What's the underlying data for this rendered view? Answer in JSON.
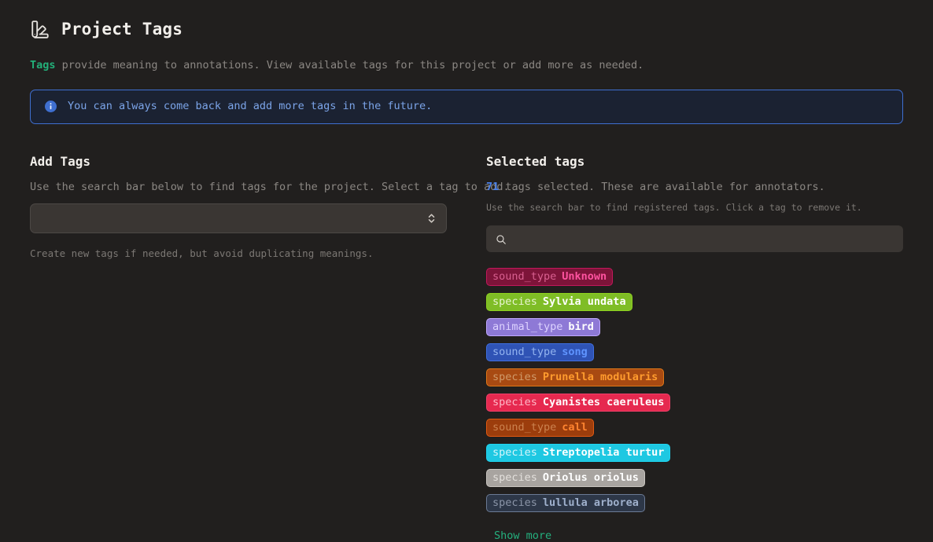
{
  "header": {
    "icon": "swatch-book-icon",
    "title": "Project Tags",
    "subtitle_keyword": "Tags",
    "subtitle_rest": " provide meaning to annotations. View available tags for this project or add more as needed."
  },
  "info_banner": {
    "icon": "info-circle-icon",
    "text": "You can always come back and add more tags in the future.",
    "border_color": "#3f6fd0",
    "background_color": "#1b2232",
    "text_color": "#7ba4e8"
  },
  "add_tags": {
    "title": "Add Tags",
    "description": "Use the search bar below to find tags for the project. Select a tag to add.",
    "select": {
      "value": "",
      "placeholder": "",
      "icon": "chevron-up-down-icon"
    },
    "helper_note": "Create new tags if needed, but avoid duplicating meanings."
  },
  "selected_tags": {
    "title": "Selected tags",
    "count": "71",
    "count_suffix": " tags selected. These are available for annotators.",
    "hint": "Use the search bar to find registered tags. Click a tag to remove it.",
    "search": {
      "icon": "search-icon",
      "value": "",
      "placeholder": ""
    },
    "show_more_label": "Show more",
    "show_more_color": "#24b07e",
    "tags": [
      {
        "key": "sound_type",
        "value": "Unknown",
        "border": "#c2185b",
        "fill": "#7d1439",
        "key_color": "#d96090",
        "value_color": "#ff53a0"
      },
      {
        "key": "species",
        "value": "Sylvia undata",
        "border": "#8ed11f",
        "fill": "#7fbd26",
        "key_color": "#e8f5d0",
        "value_color": "#ffffff"
      },
      {
        "key": "animal_type",
        "value": "bird",
        "border": "#c0a8ff",
        "fill": "#8e79d6",
        "key_color": "#ddd2ff",
        "value_color": "#ffffff"
      },
      {
        "key": "sound_type",
        "value": "song",
        "border": "#3f6fe0",
        "fill": "#2f53b5",
        "key_color": "#93b4f0",
        "value_color": "#5f94ff"
      },
      {
        "key": "species",
        "value": "Prunella modularis",
        "border": "#e07818",
        "fill": "#a84a12",
        "key_color": "#d09a6a",
        "value_color": "#ff9b2e"
      },
      {
        "key": "species",
        "value": "Cyanistes caeruleus",
        "border": "#f0406a",
        "fill": "#e6294f",
        "key_color": "#ffb9c8",
        "value_color": "#ffffff"
      },
      {
        "key": "sound_type",
        "value": "call",
        "border": "#e25a12",
        "fill": "#9c3d0c",
        "key_color": "#cc824f",
        "value_color": "#ff8430"
      },
      {
        "key": "species",
        "value": "Streptopelia turtur",
        "border": "#1fd4f0",
        "fill": "#1ec8e2",
        "key_color": "#d4f6fb",
        "value_color": "#ffffff"
      },
      {
        "key": "species",
        "value": "Oriolus oriolus",
        "border": "#c9c5c0",
        "fill": "#a8a4a0",
        "key_color": "#e3e0dc",
        "value_color": "#ffffff"
      },
      {
        "key": "species",
        "value": "lullula arborea",
        "border": "#6b7a95",
        "fill": "#2d3748",
        "key_color": "#8b95a8",
        "value_color": "#9fb0cc"
      }
    ]
  }
}
